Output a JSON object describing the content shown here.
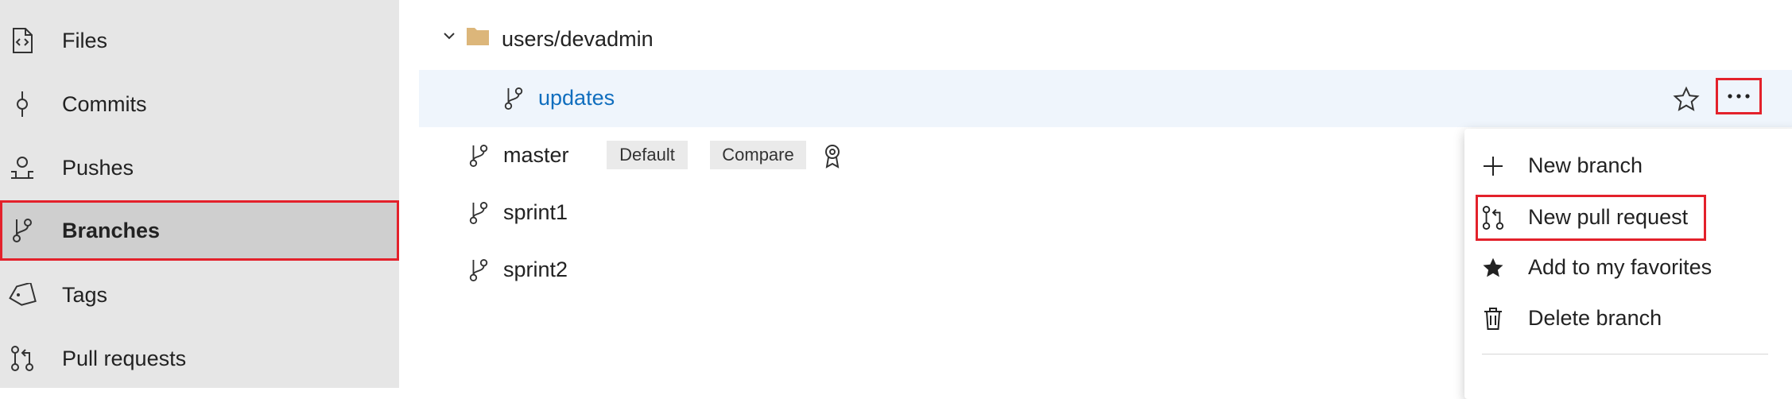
{
  "sidebar": {
    "items": [
      {
        "label": "Files",
        "icon": "file-code-icon"
      },
      {
        "label": "Commits",
        "icon": "commit-icon"
      },
      {
        "label": "Pushes",
        "icon": "push-icon"
      },
      {
        "label": "Branches",
        "icon": "branch-icon",
        "selected": true
      },
      {
        "label": "Tags",
        "icon": "tag-icon"
      },
      {
        "label": "Pull requests",
        "icon": "pull-request-icon"
      }
    ]
  },
  "tree": {
    "folder": "users/devadmin",
    "selected_branch": "updates",
    "branches": [
      {
        "name": "master",
        "badges": [
          "Default",
          "Compare"
        ]
      },
      {
        "name": "sprint1"
      },
      {
        "name": "sprint2"
      }
    ]
  },
  "context_menu": {
    "items": [
      {
        "label": "New branch",
        "icon": "plus-icon"
      },
      {
        "label": "New pull request",
        "icon": "pull-request-icon",
        "highlighted": true
      },
      {
        "label": "Add to my favorites",
        "icon": "star-filled-icon"
      },
      {
        "label": "Delete branch",
        "icon": "trash-icon"
      }
    ]
  },
  "colors": {
    "accent_link": "#106ebe",
    "highlight_border": "#e3212b",
    "selected_row_bg": "#eff5fc",
    "sidebar_bg": "#e6e6e6",
    "folder": "#dcb67a"
  }
}
